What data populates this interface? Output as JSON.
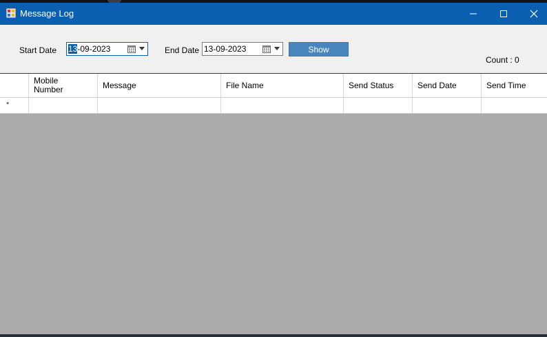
{
  "window": {
    "title": "Message Log",
    "title_bar_color": "#0a5fb0",
    "icons": [
      "app-icon",
      "minimize-icon",
      "maximize-icon",
      "close-icon"
    ]
  },
  "filters": {
    "start_label": "Start Date",
    "start_value_selected": "13",
    "start_value_rest": "-09-2023",
    "end_label": "End Date",
    "end_value": "13-09-2023",
    "show_button": "Show",
    "count_text": "Count : 0"
  },
  "grid": {
    "columns": [
      "Mobile Number",
      "Message",
      "File Name",
      "Send Status",
      "Send Date",
      "Send Time"
    ],
    "columns_display": {
      "mobile_line1": "Mobile",
      "mobile_line2": "Number"
    },
    "new_row_marker": "*"
  },
  "colors": {
    "accent": "#0a5fb0",
    "button": "#4a86be",
    "empty_grid": "#ababab"
  }
}
